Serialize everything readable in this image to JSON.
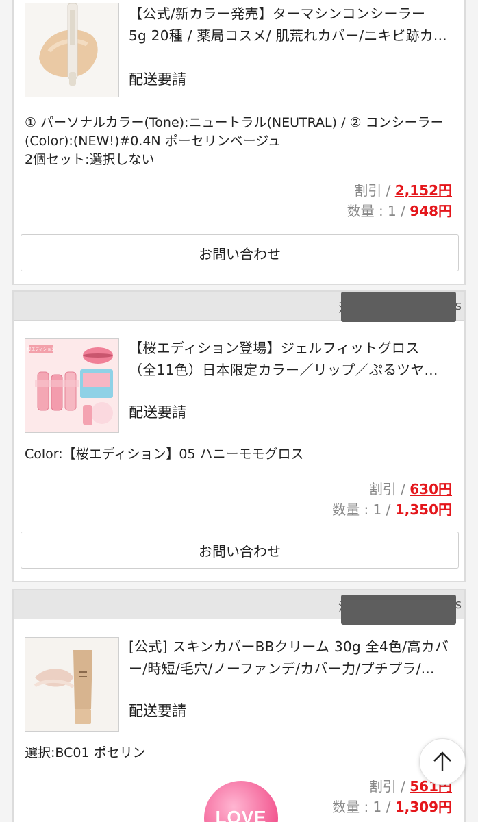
{
  "orders": [
    {
      "title_lines": [
        "【公式/新カラー発売】ターマシンコンシーラー",
        "5g 20種 / 薬局コスメ/ 肌荒れカバー/ニキビ跡カ..."
      ],
      "shipping": "配送要請",
      "options": [
        "① パーソナルカラー(Tone):ニュートラル(NEUTRAL) / ② コンシーラー (Color):(NEW!)#0.4N ポーセリンベージュ",
        "2個セット:選択しない"
      ],
      "discount_label": "割引 / ",
      "discount_value": "2,152円",
      "qty_label": "数量 : 1 / ",
      "price": "948円",
      "inquiry_label": "お問い合わせ"
    },
    {
      "header_left": "涅",
      "header_right": "s",
      "title_lines": [
        "【桜エディション登場】ジェルフィットグロス",
        "（全11色）日本限定カラー／リップ／ぷるツヤ..."
      ],
      "thumb_badge": "桜エディション",
      "shipping": "配送要請",
      "options": [
        "Color:【桜エディション】05 ハニーモモグロス"
      ],
      "discount_label": "割引 / ",
      "discount_value": "630円",
      "qty_label": "数量 : 1 / ",
      "price": "1,350円",
      "inquiry_label": "お問い合わせ"
    },
    {
      "header_left": "涅",
      "header_right": "s",
      "title_lines": [
        "[公式] スキンカバーBBクリーム 30g 全4色/高カバ",
        "ー/時短/毛穴/ノーファンデ/カバー力/プチプラ/..."
      ],
      "shipping": "配送要請",
      "options": [
        "選択:BC01 ポセリン"
      ],
      "discount_label": "割引 / ",
      "discount_value": "561円",
      "qty_label": "数量 : 1 / ",
      "price": "1,309円"
    }
  ],
  "floating": {
    "love_label": "LOVE",
    "scroll_top_icon": "arrow-up-icon"
  },
  "colors": {
    "price_red": "#e4161b",
    "love_pink": "#f2568f"
  }
}
